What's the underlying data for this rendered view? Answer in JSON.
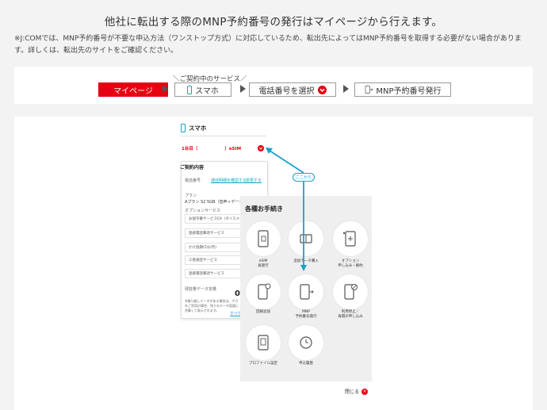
{
  "heading": "他社に転出する際のMNP予約番号の発行はマイページから行えます。",
  "note": "※J:COMでは、MNP予約番号が不要な申込方法（ワンストップ方式）に対応しているため、転出先によってはMNP予約番号を取得する必要がない場合があります。詳しくは、転出先のサイトをご確認ください。",
  "steps": {
    "caption": "＼ご契約中のサービス／",
    "items": [
      {
        "label": "マイページ"
      },
      {
        "label": "スマホ",
        "icon": "phone-icon"
      },
      {
        "label": "電話番号を選択",
        "icon": "chevron-down-icon"
      },
      {
        "label": "MNP予約番号発行",
        "icon": "mnp-icon"
      }
    ]
  },
  "mock": {
    "service_title": "スマホ",
    "line_label": "1台目（",
    "line_label_end": "）eSIM",
    "contract_title": "ご契約内容",
    "contract_rows": [
      {
        "label": "電話番号",
        "link1": "通話明細を確認する",
        "link2": "変更する"
      },
      {
        "label": "プラン",
        "value": "Aプラン S2 5GB（音声＋データ）"
      }
    ],
    "option_label": "オプションサービス",
    "options": [
      "お留守番サービスEX（ボイスメー",
      "迷惑電話撃退サービス",
      "かけ放題(5分/月)",
      "三者通話サービス",
      "迷惑電話撃退サービス"
    ],
    "data_usage_label": "残容量データ容量",
    "data_usage_value": "0",
    "data_usage_note": "※繰り越しデータがある場合は、ギガをご利用の場合、残りのデータ容量に合算して表示されます。",
    "more_link": "すべて"
  },
  "panel": {
    "title": "各種お手続き",
    "callout": "ここから",
    "items": [
      {
        "label": "eSIM\n再発行",
        "icon": "esim-icon"
      },
      {
        "label": "追加データ購入",
        "icon": "data-add-icon"
      },
      {
        "label": "オプション\n申し込み・解約",
        "icon": "option-icon"
      },
      {
        "label": "回線追加",
        "icon": "line-add-icon"
      },
      {
        "label": "MNP\n予約番号発行",
        "icon": "mnp-issue-icon"
      },
      {
        "label": "利用停止／\n再開の申し込み",
        "icon": "suspend-icon"
      },
      {
        "label": "プロファイル設定",
        "icon": "profile-icon"
      },
      {
        "label": "申込履歴",
        "icon": "history-icon"
      }
    ],
    "close": "閉じる"
  },
  "colors": {
    "accent": "#e60012",
    "link": "#1aa0c8"
  }
}
